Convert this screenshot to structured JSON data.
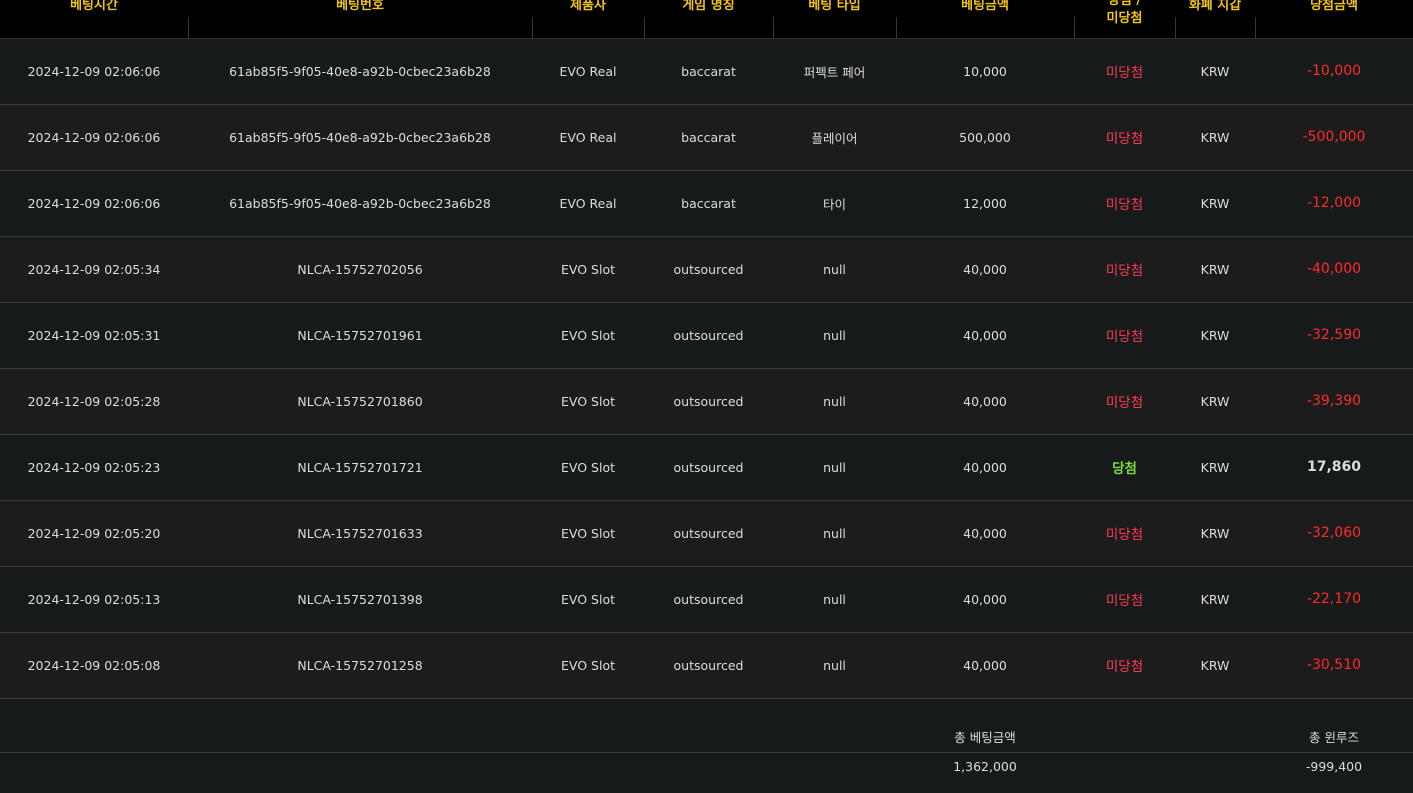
{
  "colors": {
    "header_text": "#f0c419",
    "lose_text": "#ff3b55",
    "win_text": "#7ddc3a",
    "negative_amount": "#ff2a2a",
    "row_odd": "#161a1b",
    "row_even": "#1c1c1c"
  },
  "headers": {
    "bet_time": "베팅시간",
    "bet_number": "베팅번호",
    "provider": "제품사",
    "game_name": "게임 명칭",
    "bet_type": "베팅 타입",
    "bet_amount": "베팅금액",
    "result_line1": "당첨 /",
    "result_line2": "미당첨",
    "currency": "화폐 지갑",
    "win_amount": "당첨금액"
  },
  "rows": [
    {
      "time": "2024-12-09 02:06:06",
      "bet_no": "61ab85f5-9f05-40e8-a92b-0cbec23a6b28",
      "provider": "EVO Real",
      "game": "baccarat",
      "type": "퍼펙트 페어",
      "amount": "10,000",
      "result": "미당첨",
      "currency": "KRW",
      "win": "-10,000"
    },
    {
      "time": "2024-12-09 02:06:06",
      "bet_no": "61ab85f5-9f05-40e8-a92b-0cbec23a6b28",
      "provider": "EVO Real",
      "game": "baccarat",
      "type": "플레이어",
      "amount": "500,000",
      "result": "미당첨",
      "currency": "KRW",
      "win": "-500,000"
    },
    {
      "time": "2024-12-09 02:06:06",
      "bet_no": "61ab85f5-9f05-40e8-a92b-0cbec23a6b28",
      "provider": "EVO Real",
      "game": "baccarat",
      "type": "타이",
      "amount": "12,000",
      "result": "미당첨",
      "currency": "KRW",
      "win": "-12,000"
    },
    {
      "time": "2024-12-09 02:05:34",
      "bet_no": "NLCA-15752702056",
      "provider": "EVO Slot",
      "game": "outsourced",
      "type": "null",
      "amount": "40,000",
      "result": "미당첨",
      "currency": "KRW",
      "win": "-40,000"
    },
    {
      "time": "2024-12-09 02:05:31",
      "bet_no": "NLCA-15752701961",
      "provider": "EVO Slot",
      "game": "outsourced",
      "type": "null",
      "amount": "40,000",
      "result": "미당첨",
      "currency": "KRW",
      "win": "-32,590"
    },
    {
      "time": "2024-12-09 02:05:28",
      "bet_no": "NLCA-15752701860",
      "provider": "EVO Slot",
      "game": "outsourced",
      "type": "null",
      "amount": "40,000",
      "result": "미당첨",
      "currency": "KRW",
      "win": "-39,390"
    },
    {
      "time": "2024-12-09 02:05:23",
      "bet_no": "NLCA-15752701721",
      "provider": "EVO Slot",
      "game": "outsourced",
      "type": "null",
      "amount": "40,000",
      "result": "당첨",
      "currency": "KRW",
      "win": "17,860"
    },
    {
      "time": "2024-12-09 02:05:20",
      "bet_no": "NLCA-15752701633",
      "provider": "EVO Slot",
      "game": "outsourced",
      "type": "null",
      "amount": "40,000",
      "result": "미당첨",
      "currency": "KRW",
      "win": "-32,060"
    },
    {
      "time": "2024-12-09 02:05:13",
      "bet_no": "NLCA-15752701398",
      "provider": "EVO Slot",
      "game": "outsourced",
      "type": "null",
      "amount": "40,000",
      "result": "미당첨",
      "currency": "KRW",
      "win": "-22,170"
    },
    {
      "time": "2024-12-09 02:05:08",
      "bet_no": "NLCA-15752701258",
      "provider": "EVO Slot",
      "game": "outsourced",
      "type": "null",
      "amount": "40,000",
      "result": "미당첨",
      "currency": "KRW",
      "win": "-30,510"
    }
  ],
  "summary": {
    "total_bet_label": "총 베팅금액",
    "total_bet_value": "1,362,000",
    "total_winloss_label": "총 윈루즈",
    "total_winloss_value": "-999,400"
  }
}
